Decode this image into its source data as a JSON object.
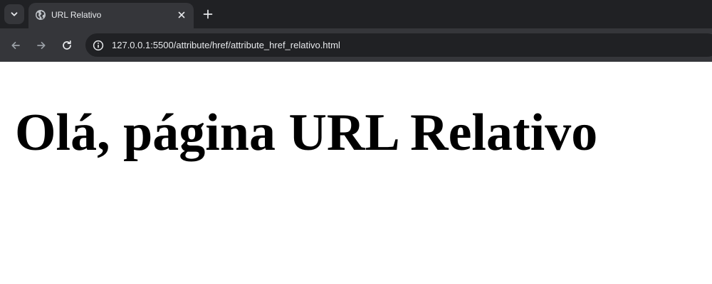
{
  "tab": {
    "title": "URL Relativo"
  },
  "address_bar": {
    "url": "127.0.0.1:5500/attribute/href/attribute_href_relativo.html"
  },
  "page": {
    "heading": "Olá, página URL Relativo"
  },
  "icons": {
    "tab_search": "chevron-down-icon",
    "favicon": "globe-icon",
    "tab_close": "close-icon",
    "new_tab": "plus-icon",
    "back": "arrow-left-icon",
    "forward": "arrow-right-icon",
    "reload": "reload-icon",
    "site_info": "info-icon"
  },
  "colors": {
    "tabstrip_bg": "#202124",
    "toolbar_bg": "#35363a",
    "omnibox_bg": "#202124",
    "text_light": "#e8eaed",
    "icon_dim": "#9aa0a6",
    "page_bg": "#ffffff",
    "heading_color": "#000000"
  }
}
